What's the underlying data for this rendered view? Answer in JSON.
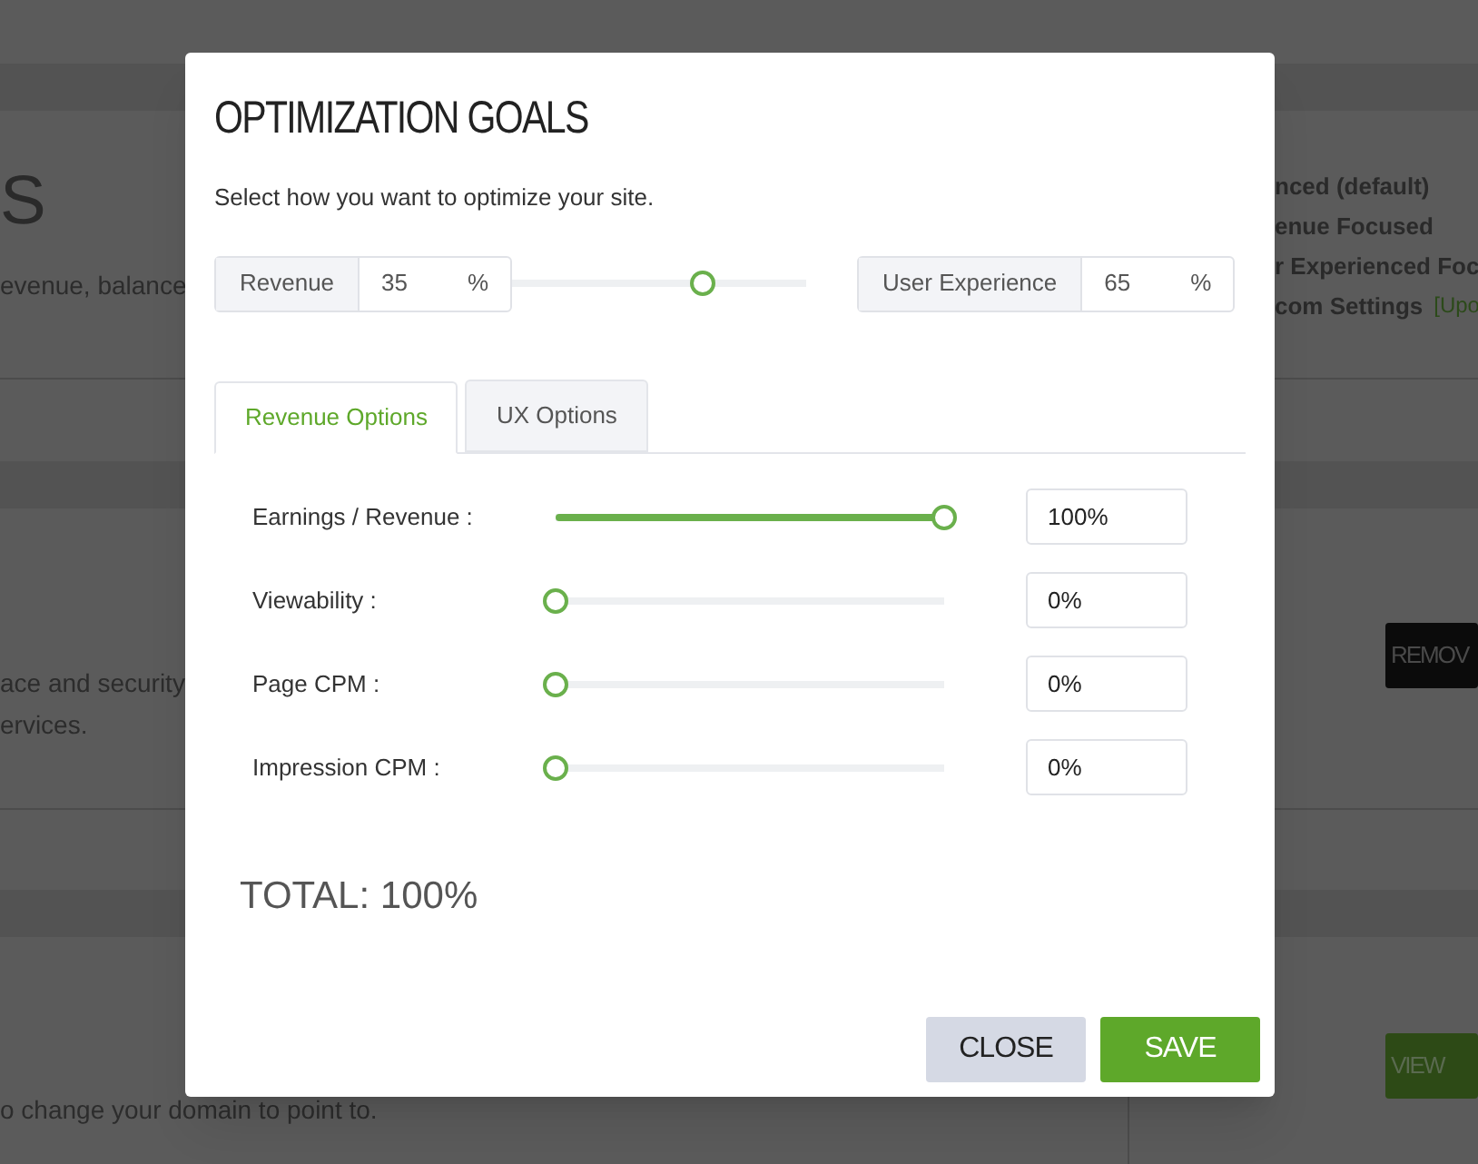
{
  "background": {
    "heading": "S",
    "lines": [
      {
        "text": "evenue, balance"
      },
      {
        "text": "ace and security"
      },
      {
        "text": "ervices."
      },
      {
        "text": "o change your domain to point to."
      }
    ],
    "options": [
      {
        "text": "nced (default)"
      },
      {
        "text": "enue Focused"
      },
      {
        "text": "r Experienced Foc"
      },
      {
        "text": "com Settings",
        "link": "[Upo"
      }
    ],
    "buttons": [
      {
        "label": "REMOV",
        "kind": "dark"
      },
      {
        "label": "VIEW",
        "kind": "green"
      }
    ]
  },
  "dialog": {
    "title": "OPTIMIZATION GOALS",
    "description": "Select how you want to optimize your site.",
    "balance": {
      "left_label": "Revenue",
      "left_value": "35",
      "left_unit": "%",
      "level": 0.65,
      "right_label": "User Experience",
      "right_value": "65",
      "right_unit": "%"
    },
    "tabs": [
      {
        "label": "Revenue Options",
        "selected": true
      },
      {
        "label": "UX Options",
        "selected": false
      }
    ],
    "options": [
      {
        "label": "Earnings / Revenue :",
        "level": 1,
        "value": "100%"
      },
      {
        "label": "Viewability :",
        "level": 0,
        "value": "0%"
      },
      {
        "label": "Page CPM :",
        "level": 0,
        "value": "0%"
      },
      {
        "label": "Impression CPM :",
        "level": 0,
        "value": "0%"
      }
    ],
    "total": "TOTAL: 100%",
    "buttons": [
      {
        "label": "CLOSE",
        "kind": "secondary"
      },
      {
        "label": "SAVE",
        "kind": "primary"
      }
    ]
  }
}
